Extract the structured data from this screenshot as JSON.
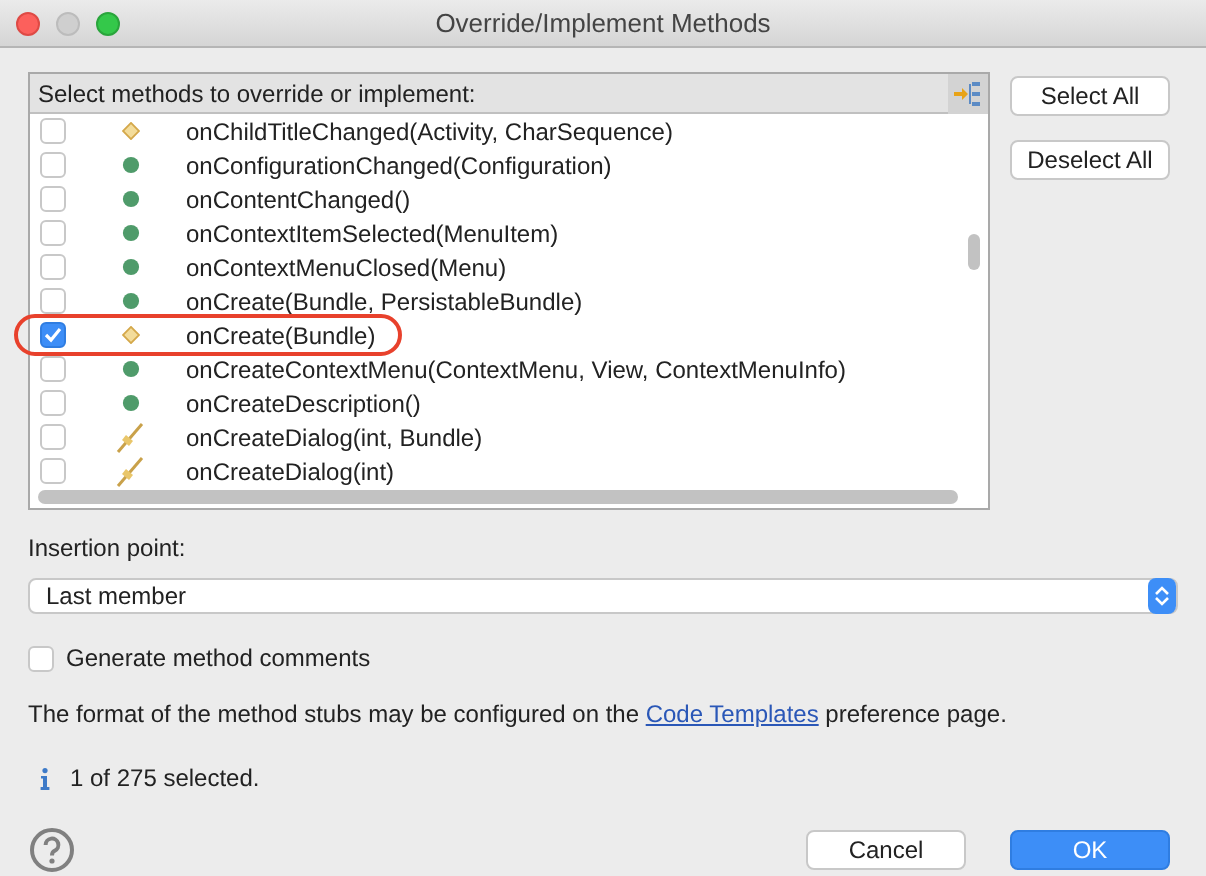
{
  "window": {
    "title": "Override/Implement Methods"
  },
  "methods": {
    "header": "Select methods to override or implement:",
    "items": [
      {
        "label": "onChildTitleChanged(Activity, CharSequence)",
        "kind": "diamond",
        "checked": false,
        "highlighted": false
      },
      {
        "label": "onConfigurationChanged(Configuration)",
        "kind": "dot",
        "checked": false,
        "highlighted": false
      },
      {
        "label": "onContentChanged()",
        "kind": "dot",
        "checked": false,
        "highlighted": false
      },
      {
        "label": "onContextItemSelected(MenuItem)",
        "kind": "dot",
        "checked": false,
        "highlighted": false
      },
      {
        "label": "onContextMenuClosed(Menu)",
        "kind": "dot",
        "checked": false,
        "highlighted": false
      },
      {
        "label": "onCreate(Bundle, PersistableBundle)",
        "kind": "dot",
        "checked": false,
        "highlighted": false
      },
      {
        "label": "onCreate(Bundle)",
        "kind": "diamond",
        "checked": true,
        "highlighted": true
      },
      {
        "label": "onCreateContextMenu(ContextMenu, View, ContextMenuInfo)",
        "kind": "dot",
        "checked": false,
        "highlighted": false
      },
      {
        "label": "onCreateDescription()",
        "kind": "dot",
        "checked": false,
        "highlighted": false
      },
      {
        "label": "onCreateDialog(int, Bundle)",
        "kind": "slash",
        "checked": false,
        "highlighted": false
      },
      {
        "label": "onCreateDialog(int)",
        "kind": "slash",
        "checked": false,
        "highlighted": false
      }
    ]
  },
  "side_buttons": [
    "Select All",
    "Deselect All"
  ],
  "insertion": {
    "label": "Insertion point:",
    "value": "Last member"
  },
  "generate_comments": {
    "label": "Generate method comments",
    "checked": false
  },
  "note": {
    "before": "The format of the method stubs may be configured on the ",
    "link": "Code Templates",
    "after": " preference page."
  },
  "status": "1 of 275 selected.",
  "buttons": [
    {
      "label": "Cancel",
      "kind": "secondary"
    },
    {
      "label": "OK",
      "kind": "primary"
    }
  ]
}
